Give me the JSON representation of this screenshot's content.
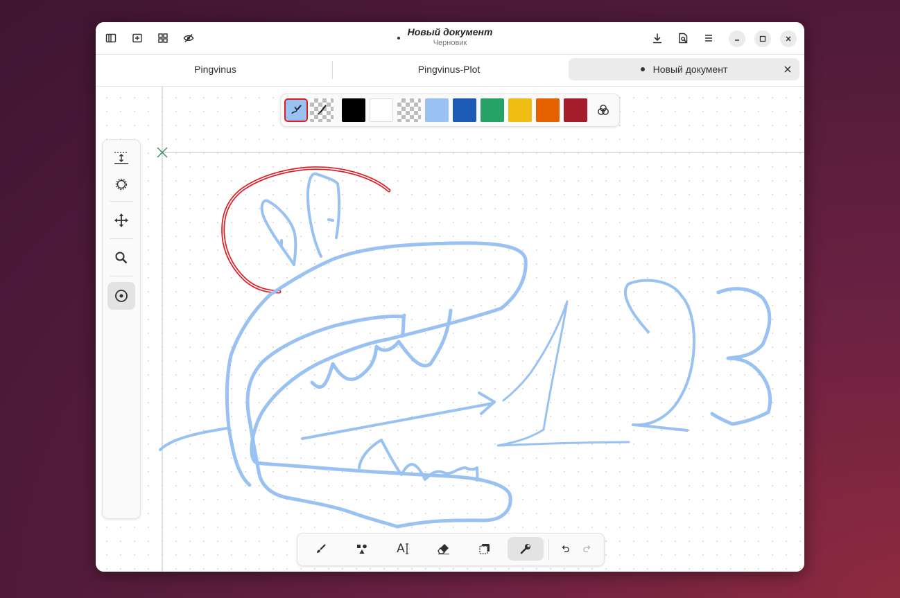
{
  "window": {
    "title": "Новый документ",
    "subtitle": "Черновик"
  },
  "tabs": [
    {
      "label": "Pingvinus",
      "active": false
    },
    {
      "label": "Pingvinus-Plot",
      "active": false
    },
    {
      "label": "Новый документ",
      "active": true,
      "modified": true
    }
  ],
  "palette": {
    "colors": [
      "#000000",
      "#ffffff",
      "transparent",
      "#99c1f1",
      "#1c5bb5",
      "#26a269",
      "#f0be12",
      "#e66100",
      "#a51d2d"
    ],
    "selected_stroke": "#99c1f1",
    "selected_outline": "#e01b24"
  },
  "sidebar": {
    "tools": [
      "page-size-icon",
      "settings-gear-icon",
      "move-icon",
      "zoom-icon",
      "target-icon"
    ],
    "active": "target-icon"
  },
  "toolbar": {
    "tools": [
      "brush-icon",
      "shapes-icon",
      "text-icon",
      "eraser-icon",
      "selection-icon",
      "wrench-icon"
    ],
    "active": "wrench-icon",
    "text_tool_glyph": "A"
  },
  "drawing": {
    "stroke_color": "#99c1f1",
    "accent_stroke": "#e01b24",
    "text": "123"
  }
}
